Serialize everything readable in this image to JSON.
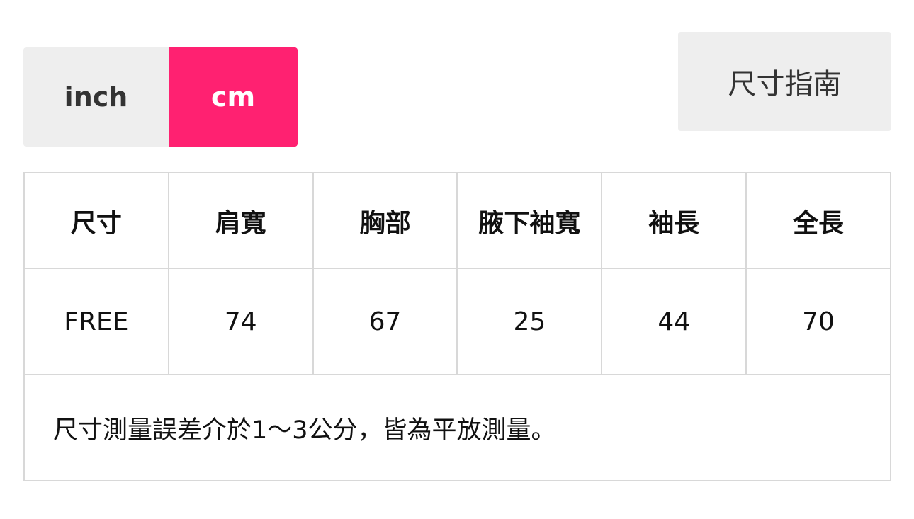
{
  "unit_toggle": {
    "options": [
      {
        "label": "inch",
        "selected": false
      },
      {
        "label": "cm",
        "selected": true
      }
    ],
    "active_color": "#ff2171",
    "inactive_color": "#eeeeee"
  },
  "size_guide_button": {
    "label": "尺寸指南"
  },
  "table": {
    "headers": [
      "尺寸",
      "肩寬",
      "胸部",
      "腋下袖寬",
      "袖長",
      "全長"
    ],
    "rows": [
      [
        "FREE",
        "74",
        "67",
        "25",
        "44",
        "70"
      ]
    ],
    "note": "尺寸測量誤差介於1～3公分，皆為平放測量。"
  }
}
